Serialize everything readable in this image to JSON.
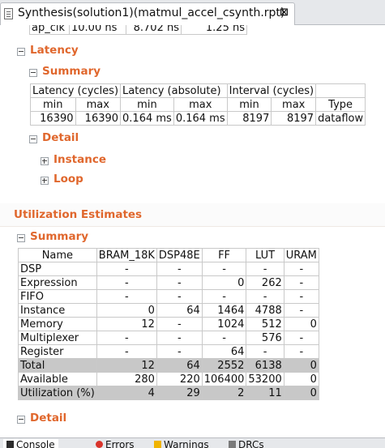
{
  "editor_tab": {
    "title": "Synthesis(solution1)(matmul_accel_csynth.rpt)",
    "close_glyph": "⊠"
  },
  "timing_row": {
    "clock": "ap_clk",
    "target": "10.00 ns",
    "estimated": "8.702 ns",
    "uncertainty": "1.25 ns"
  },
  "latency": {
    "title": "Latency",
    "summary_title": "Summary",
    "header1": [
      "Latency (cycles)",
      "Latency (absolute)",
      "Interval (cycles)",
      ""
    ],
    "header2": [
      "min",
      "max",
      "min",
      "max",
      "min",
      "max",
      "Type"
    ],
    "row": [
      "16390",
      "16390",
      "0.164 ms",
      "0.164 ms",
      "8197",
      "8197",
      "dataflow"
    ],
    "detail_title": "Detail",
    "instance_title": "Instance",
    "loop_title": "Loop"
  },
  "utilization": {
    "title": "Utilization Estimates",
    "summary_title": "Summary",
    "columns": [
      "Name",
      "BRAM_18K",
      "DSP48E",
      "FF",
      "LUT",
      "URAM"
    ],
    "rows": [
      [
        "DSP",
        "-",
        "-",
        "-",
        "-",
        "-"
      ],
      [
        "Expression",
        "-",
        "-",
        "0",
        "262",
        "-"
      ],
      [
        "FIFO",
        "-",
        "-",
        "-",
        "-",
        "-"
      ],
      [
        "Instance",
        "0",
        "64",
        "1464",
        "4788",
        "-"
      ],
      [
        "Memory",
        "12",
        "-",
        "1024",
        "512",
        "0"
      ],
      [
        "Multiplexer",
        "-",
        "-",
        "-",
        "576",
        "-"
      ],
      [
        "Register",
        "-",
        "-",
        "64",
        "-",
        "-"
      ],
      [
        "Total",
        "12",
        "64",
        "2552",
        "6138",
        "0"
      ],
      [
        "Available",
        "280",
        "220",
        "106400",
        "53200",
        "0"
      ],
      [
        "Utilization (%)",
        "4",
        "29",
        "2",
        "11",
        "0"
      ]
    ],
    "detail_title": "Detail"
  },
  "bottom_tabs": [
    "Console",
    "Errors",
    "Warnings",
    "DRCs"
  ],
  "colors": {
    "section_title": "#e0672d",
    "shaded_row": "#c8c8c8"
  }
}
